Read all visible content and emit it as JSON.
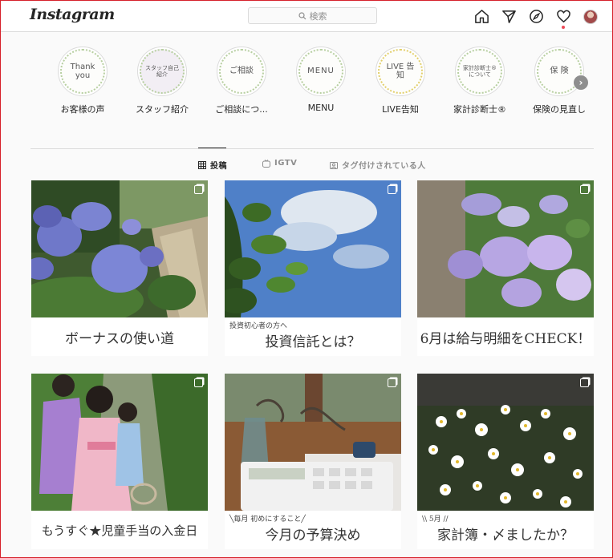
{
  "app": {
    "logo": "Instagram"
  },
  "search": {
    "placeholder": "検索"
  },
  "nav": {
    "icons": [
      "home-icon",
      "direct-icon",
      "explore-icon",
      "heart-icon",
      "avatar"
    ]
  },
  "highlights": [
    {
      "cover": "Thank you",
      "label": "お客様の声"
    },
    {
      "cover": "スタッフ自己紹介",
      "label": "スタッフ紹介"
    },
    {
      "cover": "ご相談",
      "label": "ご相談につ..."
    },
    {
      "cover": "MENU",
      "label": "MENU"
    },
    {
      "cover": "LIVE 告知",
      "label": "LIVE告知"
    },
    {
      "cover": "家計診断士® について",
      "label": "家計診断士®"
    },
    {
      "cover": "保 険",
      "label": "保険の見直し"
    }
  ],
  "tabs": [
    {
      "label": "投稿",
      "icon": "grid-icon",
      "active": true
    },
    {
      "label": "IGTV",
      "icon": "igtv-icon",
      "active": false
    },
    {
      "label": "タグ付けされている人",
      "icon": "tag-icon",
      "active": false
    }
  ],
  "posts": [
    {
      "pre": "",
      "caption": "ボーナスの使い道",
      "image": "hydrangea-garden-path"
    },
    {
      "pre": "投資初心者の方へ",
      "caption": "投資信託とは？",
      "image": "leaves-blue-sky"
    },
    {
      "pre": "",
      "caption": "6月は給与明細をCHECK！",
      "image": "hydrangea-purple"
    },
    {
      "pre": "",
      "caption": "もうすぐ★児童手当の入金日",
      "image": "children-in-dresses"
    },
    {
      "pre": "╲毎月 初めにすること╱",
      "caption": "今月の予算決め",
      "image": "calculator-on-desk"
    },
    {
      "pre": "\\\\ 5月 //",
      "caption": "家計簿・〆ましたか？",
      "image": "white-daisies"
    }
  ],
  "colors": {
    "accent_notification": "#ed4956",
    "border": "#dbdbdb",
    "text": "#262626",
    "muted": "#8e8e8e"
  }
}
